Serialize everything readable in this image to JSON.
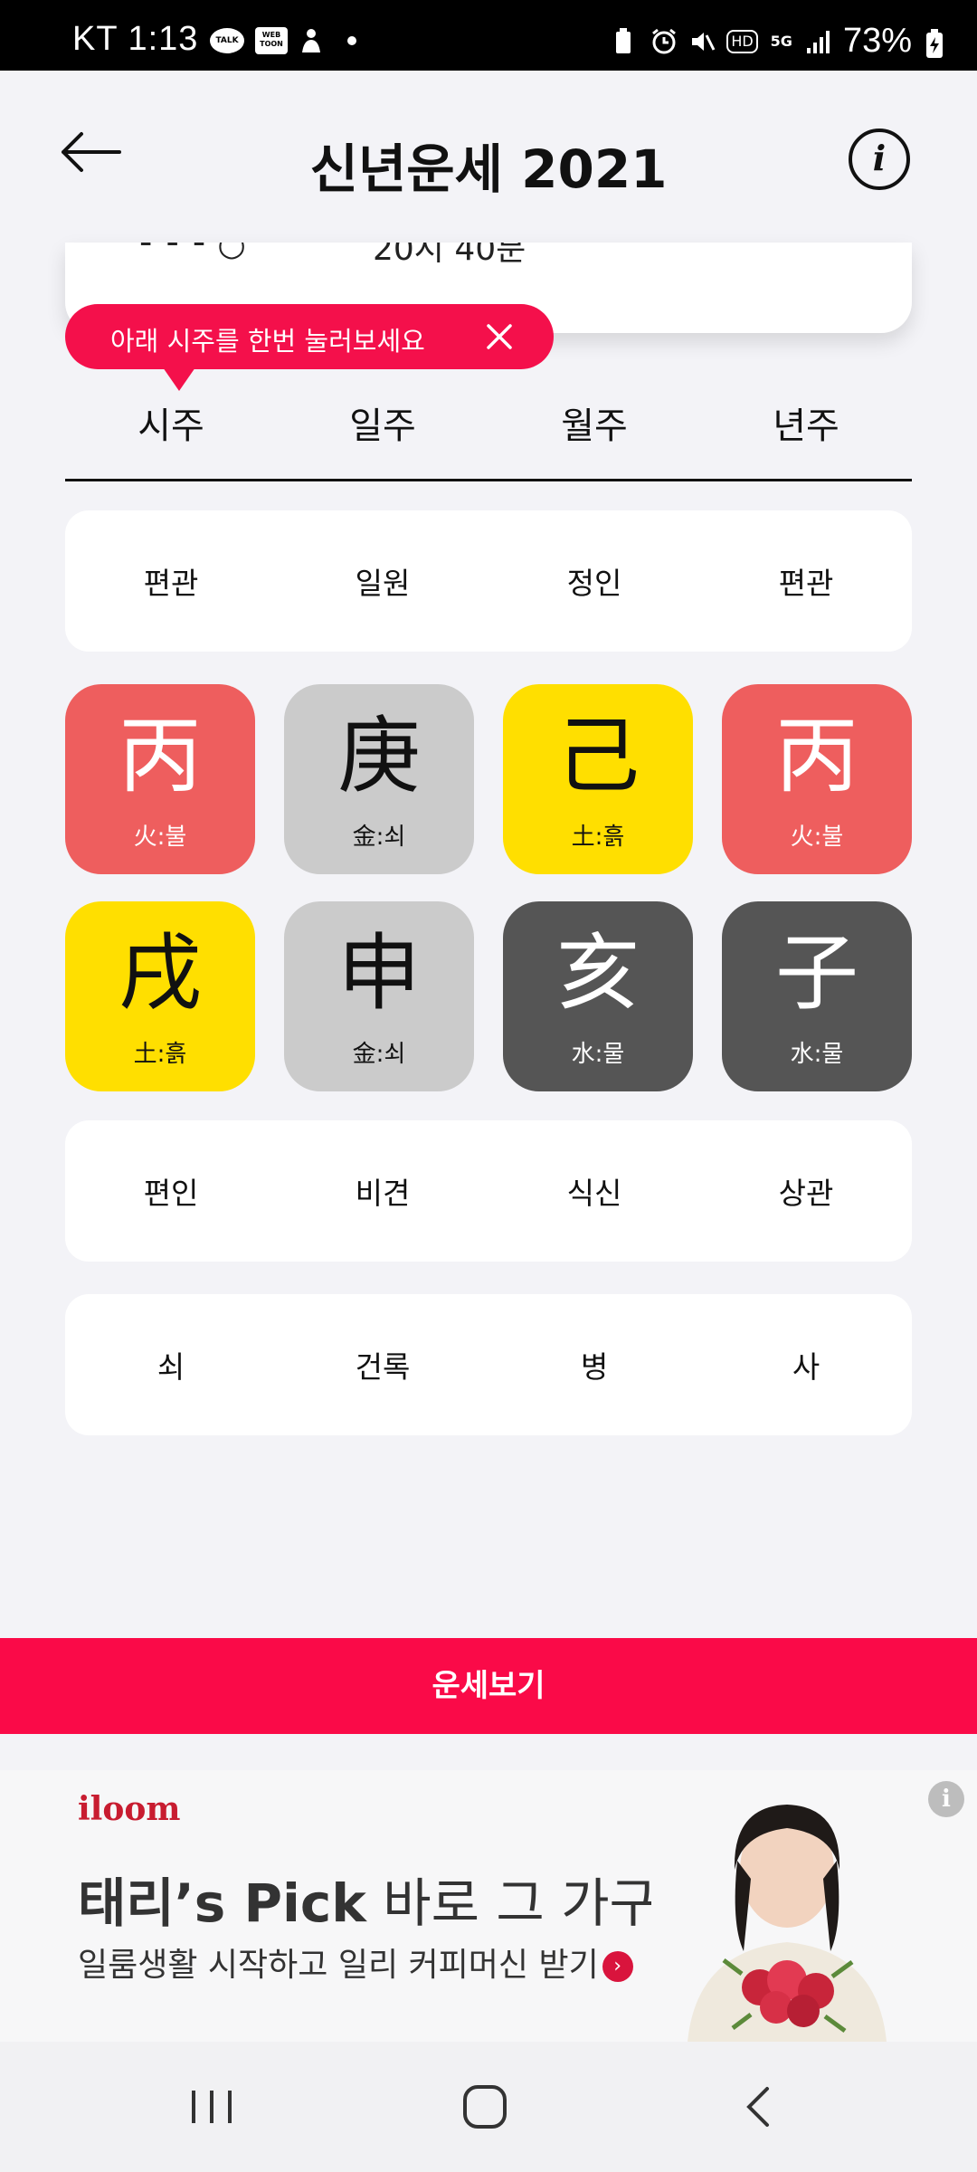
{
  "status_bar": {
    "carrier": "KT",
    "time": "1:13",
    "notif_talk": "TALK",
    "notif_webtoon": "WEB TOON",
    "hd": "HD",
    "network": "5G",
    "battery": "73%"
  },
  "header": {
    "title": "신년운세 2021",
    "info_glyph": "i"
  },
  "birth_card": {
    "partial_time": "20시 40분"
  },
  "tooltip": {
    "text": "아래 시주를 한번 눌러보세요"
  },
  "tabs": [
    "시주",
    "일주",
    "월주",
    "년주"
  ],
  "ten_gods_top": [
    "편관",
    "일원",
    "정인",
    "편관"
  ],
  "stems": [
    {
      "hanja": "丙",
      "element": "火:불",
      "color": "#ee5e5e"
    },
    {
      "hanja": "庚",
      "element": "金:쇠",
      "color": "#cbcbcb"
    },
    {
      "hanja": "己",
      "element": "土:흙",
      "color": "#ffdf00"
    },
    {
      "hanja": "丙",
      "element": "火:불",
      "color": "#ee5e5e"
    }
  ],
  "branches": [
    {
      "hanja": "戌",
      "element": "土:흙",
      "color": "#ffdf00"
    },
    {
      "hanja": "申",
      "element": "金:쇠",
      "color": "#cbcbcb"
    },
    {
      "hanja": "亥",
      "element": "水:물",
      "color": "#555555"
    },
    {
      "hanja": "子",
      "element": "水:물",
      "color": "#555555"
    }
  ],
  "ten_gods_bottom": [
    "편인",
    "비견",
    "식신",
    "상관"
  ],
  "twelve_stages": [
    "쇠",
    "건록",
    "병",
    "사"
  ],
  "cta": {
    "label": "운세보기",
    "color": "#fa0a48"
  },
  "ad": {
    "brand": "iloom",
    "headline_bold": "태리’s Pick",
    "headline_light": " 바로 그 가구!",
    "subtext": "일룸생활 시작하고 일리 커피머신 받기",
    "info_glyph": "i"
  }
}
